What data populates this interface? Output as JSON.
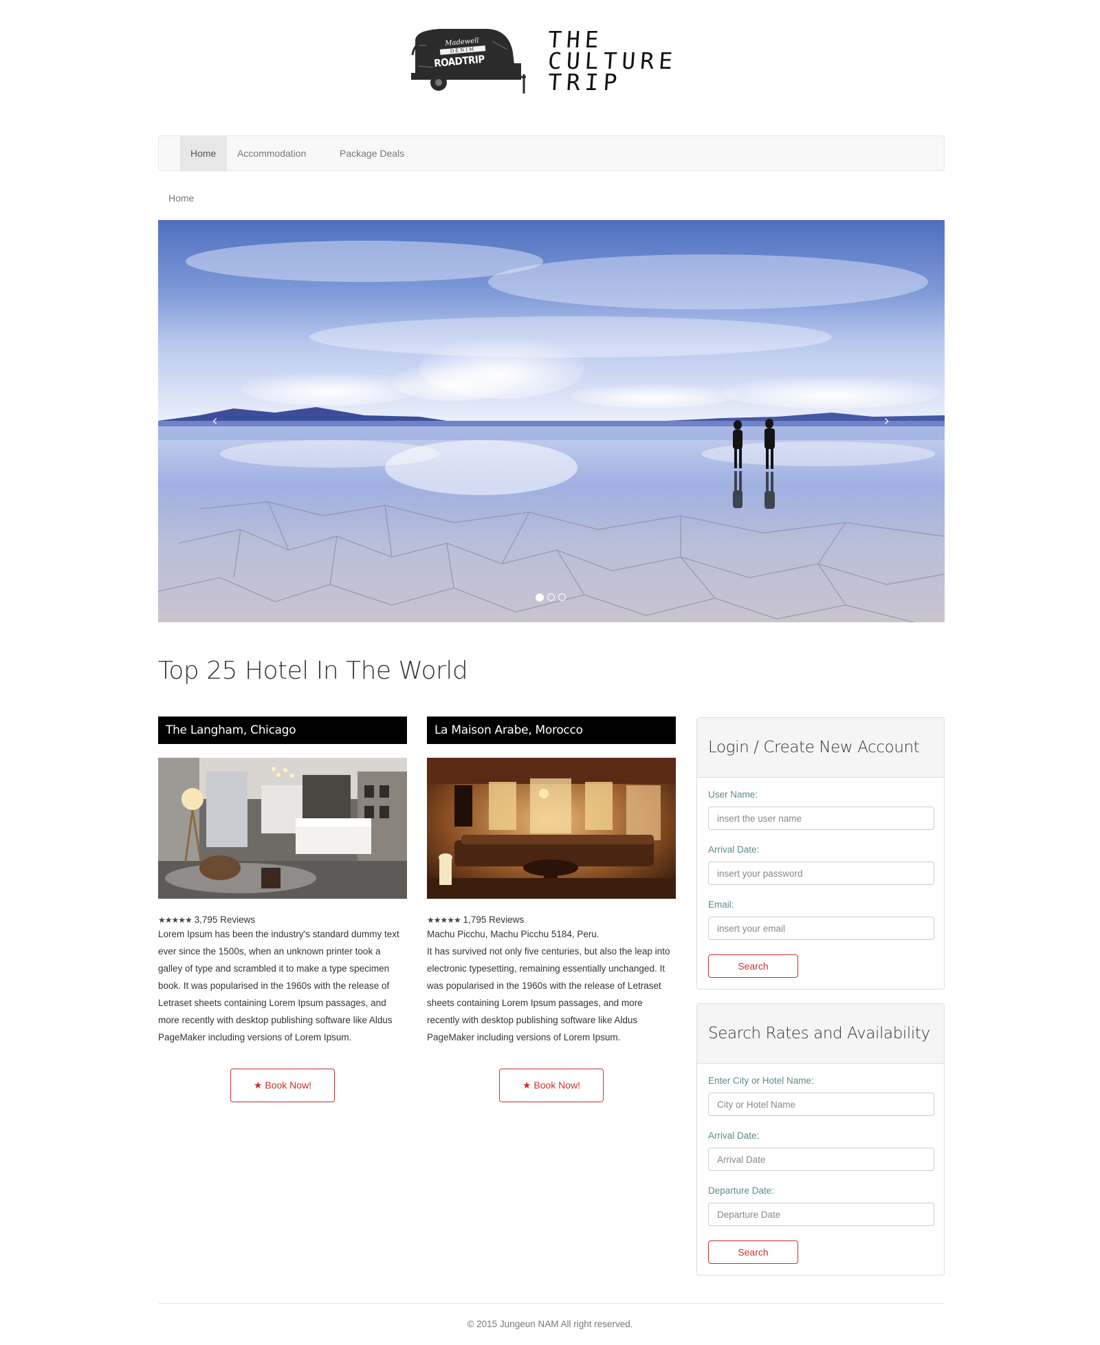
{
  "logo": {
    "trailer_top": "Madewell",
    "trailer_mid": "DENIM",
    "trailer_main": "ROADTRIP",
    "brand_lines": [
      "THE",
      "CULTURE",
      "TRIP"
    ]
  },
  "nav": {
    "items": [
      {
        "label": "Home",
        "active": true
      },
      {
        "label": "Accommodation",
        "active": false
      },
      {
        "label": "Package Deals",
        "active": false
      }
    ]
  },
  "breadcrumb": "Home",
  "carousel": {
    "prev_icon": "chevron-left-icon",
    "next_icon": "chevron-right-icon",
    "slide_count": 3,
    "active_slide": 1
  },
  "section_title": "Top 25 Hotel In The World",
  "hotels": [
    {
      "title": "The Langham, Chicago",
      "stars": "★★★★★",
      "reviews": "3,795 Reviews",
      "address": "",
      "text": "Lorem Ipsum has been the industry's standard dummy text ever since the 1500s, when an unknown printer took a galley of type and scrambled it to make a type specimen book. It was popularised in the 1960s with the release of Letraset sheets containing Lorem Ipsum passages, and more recently with desktop publishing software like Aldus PageMaker including versions of Lorem Ipsum.",
      "button": "Book Now!"
    },
    {
      "title": "La Maison Arabe, Morocco",
      "stars": "★★★★★",
      "reviews": "1,795 Reviews",
      "address": "Machu Picchu, Machu Picchu 5184, Peru.",
      "text": "It has survived not only five centuries, but also the leap into electronic typesetting, remaining essentially unchanged. It was popularised in the 1960s with the release of Letraset sheets containing Lorem Ipsum passages, and more recently with desktop publishing software like Aldus PageMaker including versions of Lorem Ipsum.",
      "button": "Book Now!"
    }
  ],
  "login_panel": {
    "title": "Login / Create New Account",
    "fields": [
      {
        "label": "User Name:",
        "placeholder": "insert the user name"
      },
      {
        "label": "Arrival Date:",
        "placeholder": "insert your password"
      },
      {
        "label": "Email:",
        "placeholder": "insert your email"
      }
    ],
    "button": "Search"
  },
  "search_panel": {
    "title": "Search Rates and Availability",
    "fields": [
      {
        "label": "Enter City or Hotel Name:",
        "placeholder": "City or Hotel Name"
      },
      {
        "label": "Arrival Date:",
        "placeholder": "Arrival Date"
      },
      {
        "label": "Departure Date:",
        "placeholder": "Departure Date"
      }
    ],
    "button": "Search"
  },
  "footer": "© 2015 Jungeun NAM All right reserved.",
  "colors": {
    "accent": "#c9302c",
    "navbar_bg": "#f8f8f8",
    "active_nav_bg": "#e7e7e7",
    "card_title_bg": "#000000"
  }
}
